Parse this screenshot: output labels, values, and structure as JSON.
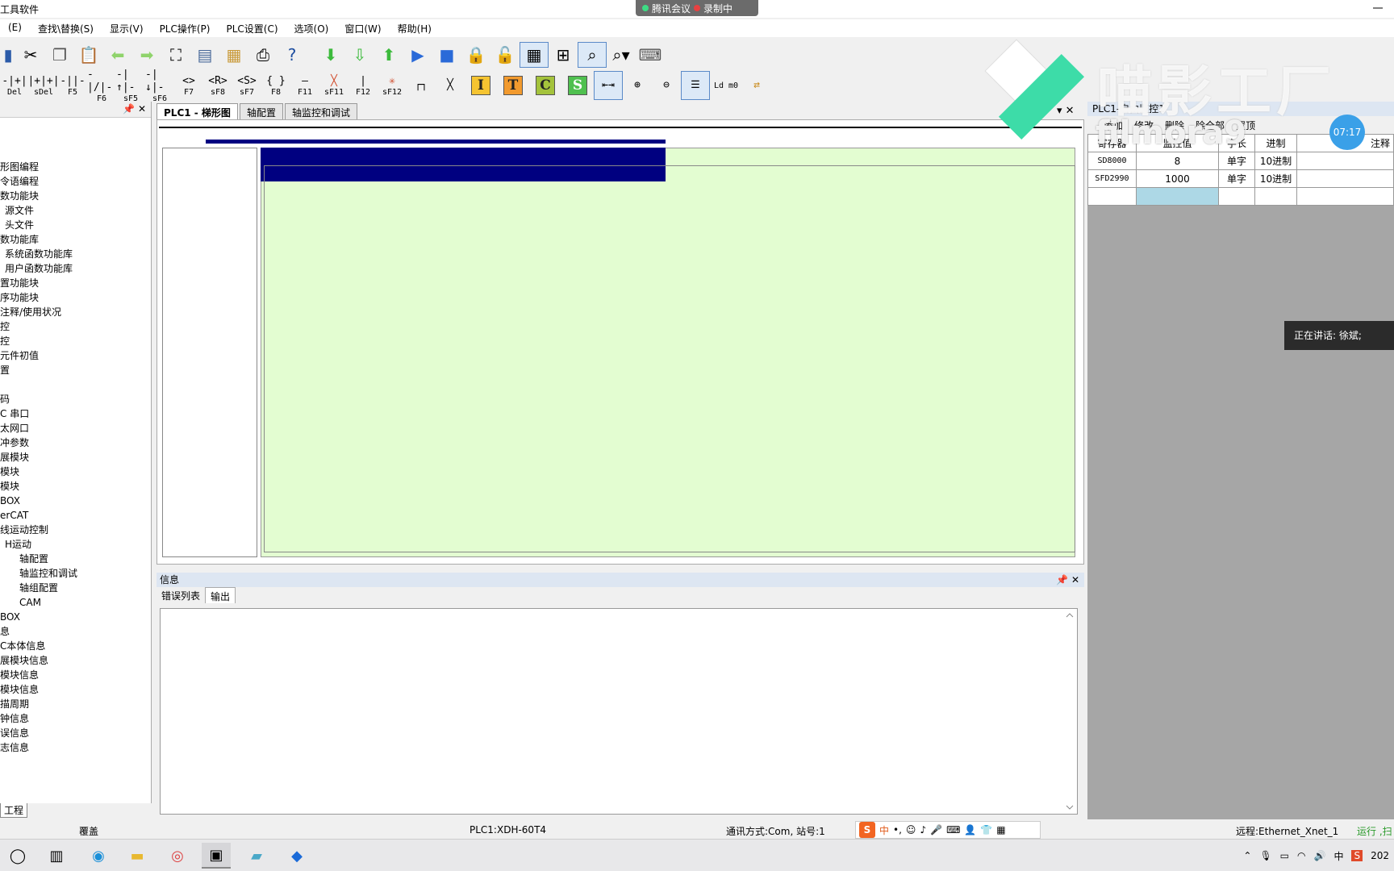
{
  "window": {
    "title": "工具软件",
    "meeting_app": "腾讯会议",
    "recording_label": "录制中"
  },
  "menu": [
    "(E)",
    "查找\\替换(S)",
    "显示(V)",
    "PLC操作(P)",
    "PLC设置(C)",
    "选项(O)",
    "窗口(W)",
    "帮助(H)"
  ],
  "toolbar2": {
    "labels": [
      "Del",
      "sDel",
      "F5",
      "F6",
      "sF5",
      "sF6",
      "F7",
      "sF8",
      "sF7",
      "F8",
      "F11",
      "sF11",
      "F12",
      "sF12"
    ],
    "glyphs": [
      "-|+|",
      "|+|+|",
      "-||-",
      "-|/|-",
      "-|↑|-",
      "-|↓|-",
      "<>",
      "<R>",
      "<S>",
      "{ }",
      "—",
      "╳",
      "|",
      "✳"
    ],
    "box_icons": [
      "I",
      "T",
      "C",
      "S"
    ],
    "ld_label": "Ld m0"
  },
  "left_panel": {
    "tab_label": "工程",
    "tree": [
      "形图编程",
      "令语编程",
      "数功能块",
      "源文件",
      "头文件",
      "数功能库",
      "系统函数功能库",
      "用户函数功能库",
      "置功能块",
      "序功能块",
      "注释/使用状况",
      "控",
      "控",
      "元件初值",
      "置",
      "",
      "码",
      "C 串口",
      "太网口",
      "冲参数",
      "展模块",
      "模块",
      "模块",
      "BOX",
      "erCAT",
      "线运动控制",
      "H运动",
      "轴配置",
      "轴监控和调试",
      "轴组配置",
      "CAM",
      "BOX",
      "息",
      "C本体信息",
      "展模块信息",
      "模块信息",
      "模块信息",
      "描周期",
      "钟信息",
      "误信息",
      "志信息"
    ]
  },
  "ladder": {
    "tabs": [
      "PLC1 - 梯形图",
      "轴配置",
      "轴监控和调试"
    ]
  },
  "info": {
    "title": "信息",
    "tabs": [
      "错误列表",
      "输出"
    ]
  },
  "monitor": {
    "title": "PLC1-自由监控1",
    "toolbar": [
      "添加",
      "修改",
      "删除",
      "除全部",
      "置顶"
    ],
    "columns": [
      "寄存器",
      "监控值",
      "字长",
      "进制",
      "注释"
    ],
    "rows": [
      {
        "reg": "SD8000",
        "value": "8",
        "size": "单字",
        "base": "10进制",
        "note": ""
      },
      {
        "reg": "SFD2990",
        "value": "1000",
        "size": "单字",
        "base": "10进制",
        "note": ""
      }
    ]
  },
  "overlay": {
    "speaking": "正在讲话: 徐斌;",
    "timer": "07:17",
    "watermark_cn": "喵影工厂",
    "watermark_en": "filmora9"
  },
  "status": {
    "mode": "覆盖",
    "plc": "PLC1:XDH-60T4",
    "comm": "通讯方式:Com, 站号:1",
    "remote": "远程:Ethernet_Xnet_1",
    "run": "运行 ,扫"
  },
  "ime": {
    "lang": "中"
  },
  "taskbar": {
    "lang": "中",
    "year": "202"
  }
}
